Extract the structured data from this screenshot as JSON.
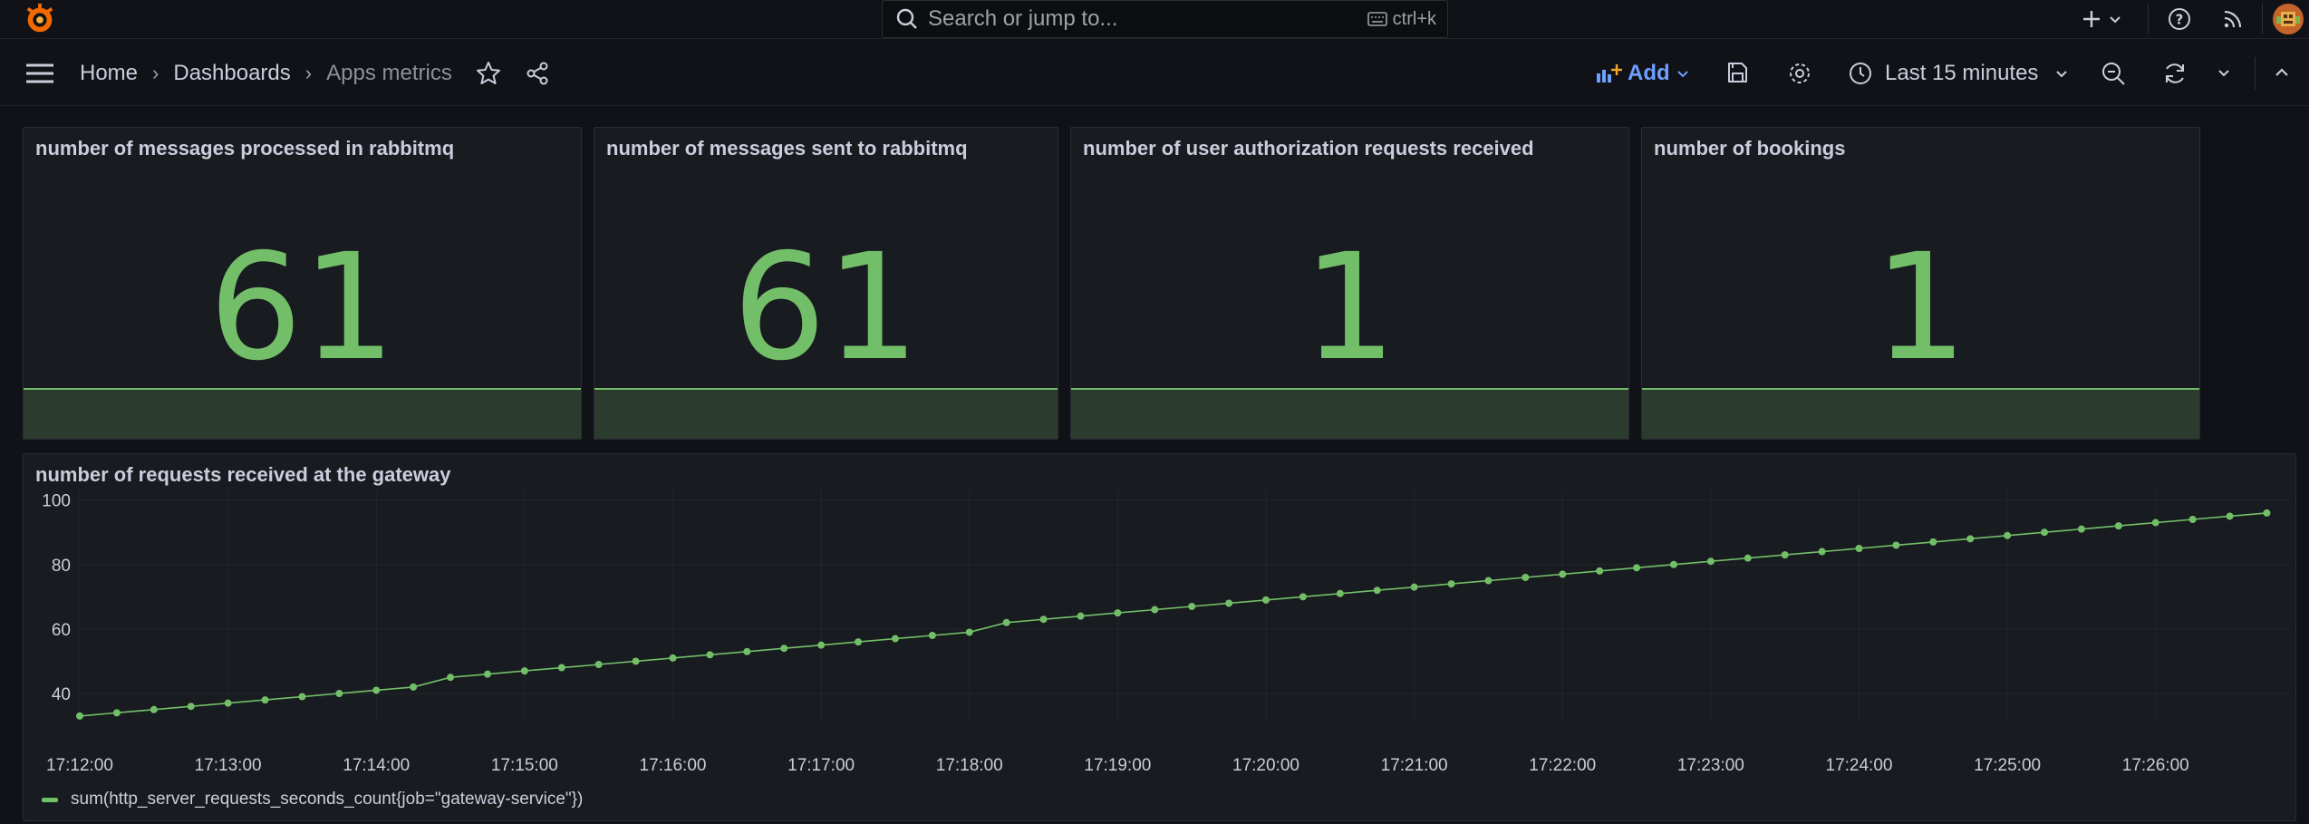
{
  "topbar": {
    "search_placeholder": "Search or jump to...",
    "search_shortcut": "ctrl+k"
  },
  "breadcrumb": [
    "Home",
    "Dashboards",
    "Apps metrics"
  ],
  "toolbar": {
    "add_label": "Add",
    "time_range": "Last 15 minutes"
  },
  "colors": {
    "accent": "#73bf69",
    "link": "#6e9fff",
    "background": "#111217",
    "panel": "#181b1f"
  },
  "stats": [
    {
      "title": "number of messages processed in rabbitmq",
      "value": "61"
    },
    {
      "title": "number of messages sent to rabbitmq",
      "value": "61"
    },
    {
      "title": "number of user authorization requests received",
      "value": "1"
    },
    {
      "title": "number of bookings",
      "value": "1"
    }
  ],
  "timeseries": {
    "title": "number of requests received at the gateway",
    "legend": "sum(http_server_requests_seconds_count{job=\"gateway-service\"})"
  },
  "chart_data": {
    "type": "line",
    "title": "number of requests received at the gateway",
    "xlabel": "",
    "ylabel": "",
    "x_tick_labels": [
      "17:12:00",
      "17:13:00",
      "17:14:00",
      "17:15:00",
      "17:16:00",
      "17:17:00",
      "17:18:00",
      "17:19:00",
      "17:20:00",
      "17:21:00",
      "17:22:00",
      "17:23:00",
      "17:24:00",
      "17:25:00",
      "17:26:00"
    ],
    "y_tick_labels": [
      "40",
      "60",
      "80",
      "100"
    ],
    "xlim_minutes": [
      0,
      14.9
    ],
    "ylim": [
      31,
      103
    ],
    "grid": true,
    "legend_placement": "bottom-left",
    "series": [
      {
        "name": "sum(http_server_requests_seconds_count{job=\"gateway-service\"})",
        "color": "#73bf69",
        "x_minutes": [
          0,
          0.25,
          0.5,
          0.75,
          1,
          1.25,
          1.5,
          1.75,
          2,
          2.25,
          2.5,
          2.75,
          3,
          3.25,
          3.5,
          3.75,
          4,
          4.25,
          4.5,
          4.75,
          5,
          5.25,
          5.5,
          5.75,
          6,
          6.25,
          6.5,
          6.75,
          7,
          7.25,
          7.5,
          7.75,
          8,
          8.25,
          8.5,
          8.75,
          9,
          9.25,
          9.5,
          9.75,
          10,
          10.25,
          10.5,
          10.75,
          11,
          11.25,
          11.5,
          11.75,
          12,
          12.25,
          12.5,
          12.75,
          13,
          13.25,
          13.5,
          13.75,
          14,
          14.25,
          14.5,
          14.75
        ],
        "values": [
          33,
          34,
          35,
          36,
          37,
          38,
          39,
          40,
          41,
          42,
          45,
          46,
          47,
          48,
          49,
          50,
          51,
          52,
          53,
          54,
          55,
          56,
          57,
          58,
          59,
          62,
          63,
          64,
          65,
          66,
          67,
          68,
          69,
          70,
          71,
          72,
          73,
          74,
          75,
          76,
          77,
          78,
          79,
          80,
          81,
          82,
          83,
          84,
          85,
          86,
          87,
          88,
          89,
          90,
          91,
          92,
          93,
          94,
          95,
          96
        ]
      }
    ]
  }
}
